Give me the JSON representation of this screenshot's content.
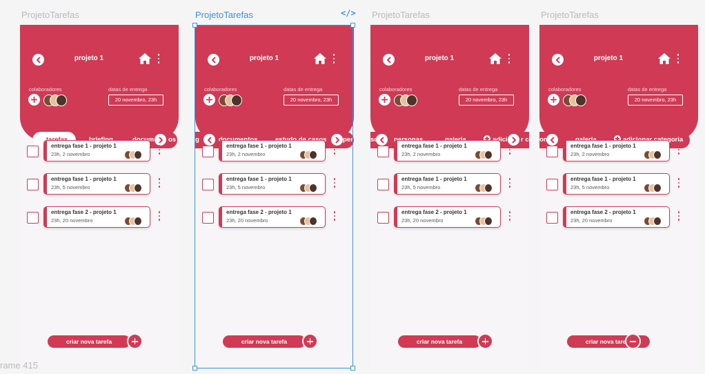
{
  "app": {
    "frame_name": "ProjetoTarefas",
    "bottom_frame_label": "rame 415"
  },
  "colors": {
    "accent": "#d03a54",
    "selection": "#3a8fe0"
  },
  "header": {
    "project_title": "projeto 1",
    "collaborators_label": "colaboradores",
    "dates_label": "datas de entrega",
    "date_value": "20 novembro, 23h"
  },
  "frames": [
    {
      "tabs": [
        "tarefas",
        "briefing",
        "docum",
        "os"
      ]
    },
    {
      "tabs": [
        "g",
        "documentos",
        "estudo de casos",
        "per"
      ]
    },
    {
      "tabs": [
        "sos",
        "personas",
        "galeria",
        "adici",
        "r c"
      ]
    },
    {
      "tabs": [
        "on",
        "galeria",
        "adicionar categoria"
      ]
    }
  ],
  "tasks": [
    {
      "title": "entrega fase 1 - projeto 1",
      "date": "23h, 2 novembro"
    },
    {
      "title": "entrega fase 1 - projeto 1",
      "date": "23h, 5 novembro"
    },
    {
      "title": "entrega fase 2 - projeto 1",
      "date": "23h, 20 novembro"
    }
  ],
  "create_task_label": "criar nova tarefa"
}
